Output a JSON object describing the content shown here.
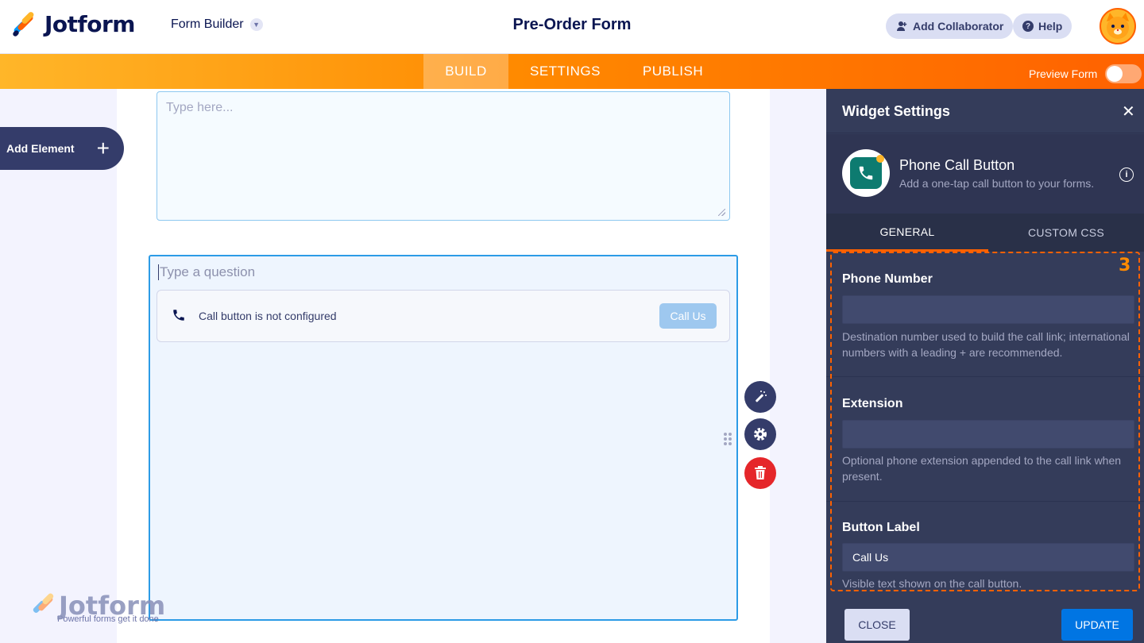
{
  "header": {
    "logo_text": "Jotform",
    "builder_label": "Form Builder",
    "form_title": "Pre-Order Form",
    "add_collaborator": "Add Collaborator",
    "help": "Help"
  },
  "nav": {
    "tabs": [
      {
        "label": "BUILD",
        "active": true
      },
      {
        "label": "SETTINGS",
        "active": false
      },
      {
        "label": "PUBLISH",
        "active": false
      }
    ],
    "preview_label": "Preview Form",
    "preview_enabled": false
  },
  "canvas": {
    "add_element_label": "Add Element",
    "textarea_placeholder": "Type here...",
    "question_placeholder": "Type a question",
    "widget_message": "Call button is not configured",
    "widget_button": "Call Us",
    "watermark_logo": "Jotform",
    "watermark_tagline": "Powerful forms get it done"
  },
  "panel": {
    "title": "Widget Settings",
    "widget_name": "Phone Call Button",
    "widget_description": "Add a one-tap call button to your forms.",
    "tabs": [
      {
        "label": "GENERAL",
        "active": true
      },
      {
        "label": "CUSTOM CSS",
        "active": false
      }
    ],
    "step_badge": "3",
    "fields": [
      {
        "label": "Phone Number",
        "value": "",
        "help": "Destination number used to build the call link; international numbers with a leading + are recommended."
      },
      {
        "label": "Extension",
        "value": "",
        "help": "Optional phone extension appended to the call link when present."
      },
      {
        "label": "Button Label",
        "value": "Call Us",
        "help": "Visible text shown on the call button."
      }
    ],
    "close_button": "CLOSE",
    "update_button": "UPDATE"
  },
  "colors": {
    "accent_orange": "#ff6100",
    "brand_navy": "#0a1551",
    "panel_bg": "#343c5a",
    "update_blue": "#0075e3",
    "selection_blue": "#2c9be6",
    "delete_red": "#e5262a"
  },
  "icons": {
    "logo": "jotform-logo-icon",
    "collaborator": "user-plus-icon",
    "help": "question-circle-icon",
    "avatar": "cat-avatar-icon",
    "phone": "phone-icon",
    "wand": "magic-wand-icon",
    "settings": "gear-icon",
    "delete": "trash-icon",
    "drag": "drag-handle-icon",
    "close": "close-icon",
    "info": "info-icon",
    "add": "plus-icon"
  }
}
